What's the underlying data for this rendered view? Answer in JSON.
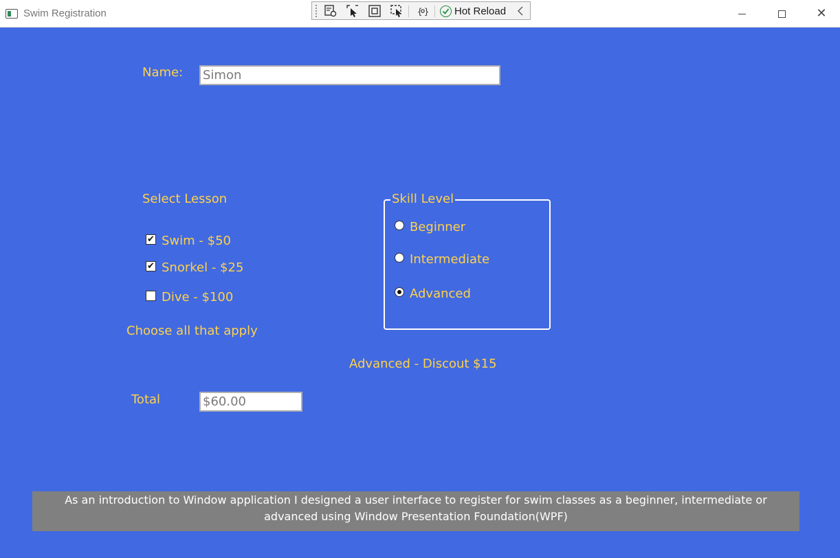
{
  "window": {
    "title": "Swim Registration"
  },
  "debug_toolbar": {
    "hot_reload_label": "Hot Reload",
    "icons": [
      "select-element-icon",
      "track-focus-icon",
      "display-adorners-icon",
      "binding-failures-icon",
      "xaml-binding-icon"
    ]
  },
  "form": {
    "name_label": "Name:",
    "name_value": "Simon",
    "select_lesson_label": "Select Lesson",
    "lessons": [
      {
        "label": "Swim - $50",
        "checked": true
      },
      {
        "label": "Snorkel - $25",
        "checked": true
      },
      {
        "label": "Dive - $100",
        "checked": false
      }
    ],
    "choose_hint": "Choose all that apply",
    "skill_level": {
      "legend": "Skill Level",
      "options": [
        {
          "label": "Beginner",
          "selected": false
        },
        {
          "label": "Intermediate",
          "selected": false
        },
        {
          "label": "Advanced",
          "selected": true
        }
      ]
    },
    "discount_text": "Advanced - Discout $15",
    "total_label": "Total",
    "total_value": "$60.00"
  },
  "footer": {
    "description": "As an introduction to Window application I designed a user interface to register for swim classes as a beginner, intermediate or advanced using Window Presentation Foundation(WPF)"
  },
  "colors": {
    "background": "#4169e1",
    "label_text": "#ffd24a",
    "footer_bg": "#808080",
    "footer_text": "#ffffff"
  }
}
